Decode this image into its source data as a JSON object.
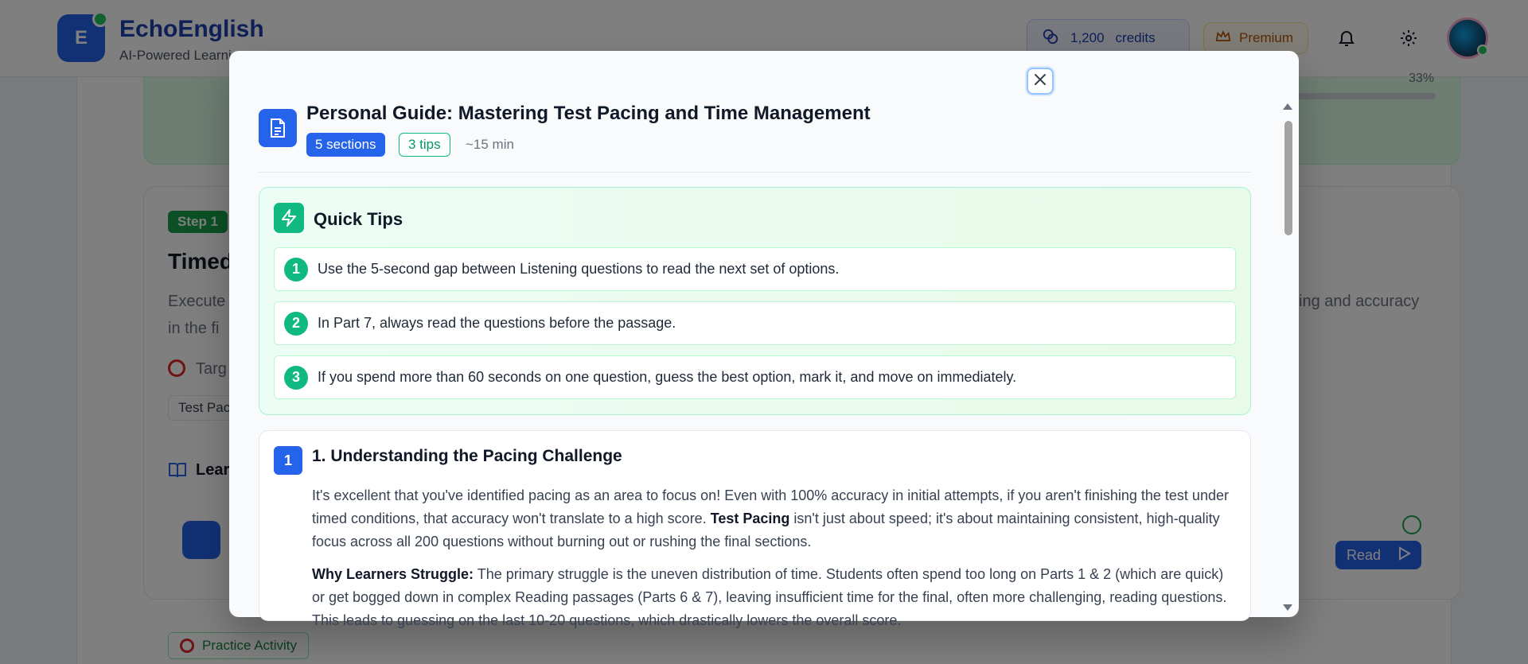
{
  "app": {
    "logo_letter": "E",
    "name": "EchoEnglish",
    "tagline": "AI-Powered Learning",
    "credits_amount": "1,200",
    "credits_label": "credits",
    "premium_label": "Premium"
  },
  "background": {
    "progress_pct": "33%",
    "step_badge": "Step 1",
    "step_title": "Timed",
    "step_desc_line1": "Execute",
    "step_desc_right": "cing and accuracy",
    "step_desc_line2": "in the fi",
    "target_label": "Targ",
    "tag_chip": "Test Pac",
    "learn_label": "Lear",
    "read_button": "Read",
    "practice_chip": "Practice Activity"
  },
  "modal": {
    "title": "Personal Guide: Mastering Test Pacing and Time Management",
    "sections_chip": "5 sections",
    "tips_chip": "3 tips",
    "time_estimate": "~15 min",
    "quick_tips": {
      "heading": "Quick Tips",
      "items": [
        {
          "num": "1",
          "text": "Use the 5-second gap between Listening questions to read the next set of options."
        },
        {
          "num": "2",
          "text": "In Part 7, always read the questions before the passage."
        },
        {
          "num": "3",
          "text": "If you spend more than 60 seconds on one question, guess the best option, mark it, and move on immediately."
        }
      ]
    },
    "section1": {
      "num": "1",
      "title": "1. Understanding the Pacing Challenge",
      "p1_a": "It's excellent that you've identified pacing as an area to focus on! Even with 100% accuracy in initial attempts, if you aren't finishing the test under timed conditions, that accuracy won't translate to a high score. ",
      "p1_bold": "Test Pacing",
      "p1_b": " isn't just about speed; it's about maintaining consistent, high-quality focus across all 200 questions without burning out or rushing the final sections.",
      "p2_bold": "Why Learners Struggle:",
      "p2_text": " The primary struggle is the uneven distribution of time. Students often spend too long on Parts 1 & 2 (which are quick) or get bogged down in complex Reading passages (Parts 6 & 7), leaving insufficient time for the final, often more challenging, reading questions. This leads to guessing on the last 10-20 questions, which drastically lowers the overall score."
    }
  },
  "colors": {
    "primary": "#2563eb",
    "accent_green": "#10b981",
    "premium": "#b45309"
  }
}
